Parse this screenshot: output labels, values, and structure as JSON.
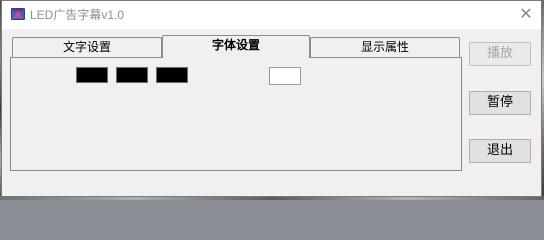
{
  "window": {
    "title": "LED广告字幕v1.0",
    "close_symbol": "✕"
  },
  "tabs": [
    {
      "label": "文字设置",
      "active": false
    },
    {
      "label": "字体设置",
      "active": true
    },
    {
      "label": "显示属性",
      "active": false
    }
  ],
  "panel": {
    "swatches": [
      {
        "color": "#000000"
      },
      {
        "color": "#000000"
      },
      {
        "color": "#000000"
      }
    ],
    "preview_box": {
      "color": "#ffffff"
    }
  },
  "buttons": {
    "play": {
      "label": "播放",
      "enabled": false
    },
    "pause": {
      "label": "暂停",
      "enabled": true
    },
    "exit": {
      "label": "退出",
      "enabled": true
    }
  },
  "icons": {
    "app": "app-icon",
    "close": "close-icon"
  }
}
